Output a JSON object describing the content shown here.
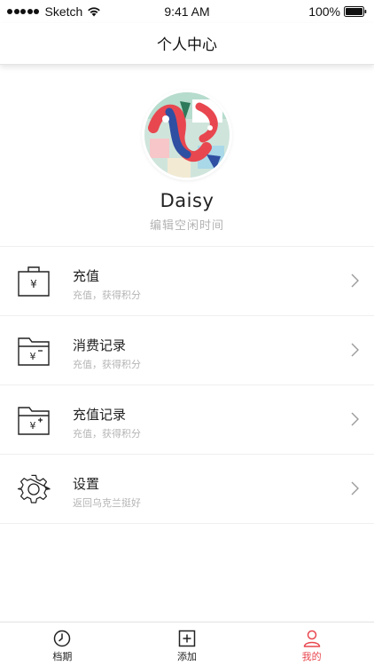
{
  "status_bar": {
    "carrier": "Sketch",
    "time": "9:41 AM",
    "battery": "100%"
  },
  "nav": {
    "title": "个人中心"
  },
  "profile": {
    "name": "Daisy",
    "subtitle": "编辑空闲时间"
  },
  "menu": [
    {
      "title": "充值",
      "subtitle": "充值，获得积分",
      "icon": "wallet-yen-icon"
    },
    {
      "title": "消费记录",
      "subtitle": "充值，获得积分",
      "icon": "folder-yen-minus-icon"
    },
    {
      "title": "充值记录",
      "subtitle": "充值，获得积分",
      "icon": "folder-yen-plus-icon"
    },
    {
      "title": "设置",
      "subtitle": "返回乌克兰挺好",
      "icon": "gear-icon"
    }
  ],
  "tabs": [
    {
      "label": "档期",
      "icon": "clock-icon",
      "active": false
    },
    {
      "label": "添加",
      "icon": "add-square-icon",
      "active": false
    },
    {
      "label": "我的",
      "icon": "user-icon",
      "active": true
    }
  ],
  "colors": {
    "accent": "#e8474f",
    "text": "#222222",
    "subtext": "#b5b5b5",
    "divider": "#efefef"
  }
}
